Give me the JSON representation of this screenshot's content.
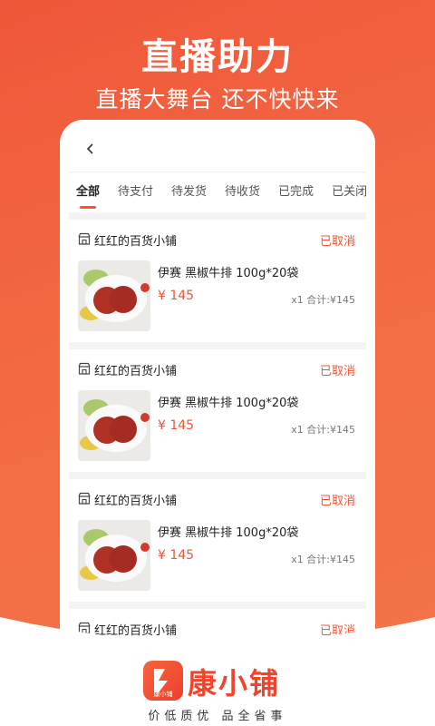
{
  "banner": {
    "headline": "直播助力",
    "subline": "直播大舞台 还不快快来"
  },
  "tabs": [
    "全部",
    "待支付",
    "待发货",
    "待收货",
    "已完成",
    "已关闭"
  ],
  "active_tab": 0,
  "orders": [
    {
      "shop": "红红的百货小铺",
      "status": "已取消",
      "product": "伊赛 黑椒牛排 100g*20袋",
      "price": "¥ 145",
      "qty_total": "x1 合计:¥145"
    },
    {
      "shop": "红红的百货小铺",
      "status": "已取消",
      "product": "伊赛 黑椒牛排 100g*20袋",
      "price": "¥ 145",
      "qty_total": "x1 合计:¥145"
    },
    {
      "shop": "红红的百货小铺",
      "status": "已取消",
      "product": "伊赛 黑椒牛排 100g*20袋",
      "price": "¥ 145",
      "qty_total": "x1 合计:¥145"
    },
    {
      "shop": "红红的百货小铺",
      "status": "已取消"
    }
  ],
  "brand": {
    "logo_label": "康小铺",
    "name": "康小铺",
    "slogan": "价低质优 品全省事"
  },
  "colors": {
    "accent": "#f05537",
    "background": "#f26a44"
  }
}
